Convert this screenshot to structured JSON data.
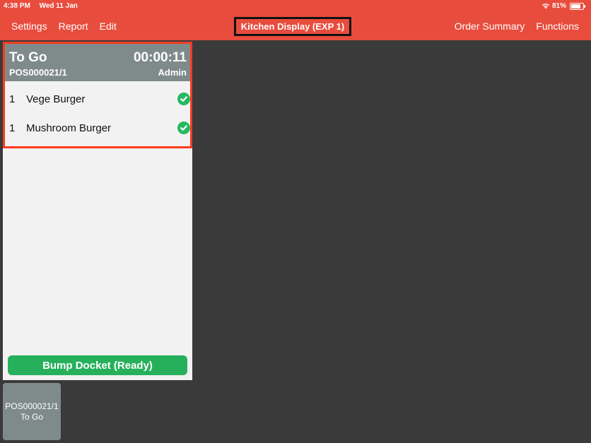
{
  "status_bar": {
    "time": "4:38 PM",
    "date": "Wed 11 Jan",
    "battery": "81%",
    "battery_level": 0.81,
    "wifi_icon": "wifi-icon",
    "battery_icon": "battery-icon"
  },
  "nav": {
    "left": [
      {
        "label": "Settings"
      },
      {
        "label": "Report"
      },
      {
        "label": "Edit"
      }
    ],
    "title": "Kitchen Display (EXP 1)",
    "right": [
      {
        "label": "Order Summary"
      },
      {
        "label": "Functions"
      }
    ]
  },
  "docket": {
    "type": "To Go",
    "order_no": "POS000021/1",
    "timer": "00:00:11",
    "user": "Admin",
    "items": [
      {
        "qty": "1",
        "name": "Vege Burger",
        "status_icon": "check-circle-icon"
      },
      {
        "qty": "1",
        "name": "Mushroom Burger",
        "status_icon": "check-circle-icon"
      }
    ],
    "bump_label": "Bump Docket (Ready)"
  },
  "thumbnails": [
    {
      "order_no": "POS000021/1",
      "type": "To Go"
    }
  ],
  "colors": {
    "header_bg": "#e84c3d",
    "docket_header_bg": "#7f8b8a",
    "ready_green": "#27b05c",
    "highlight": "#ff3b1f"
  }
}
